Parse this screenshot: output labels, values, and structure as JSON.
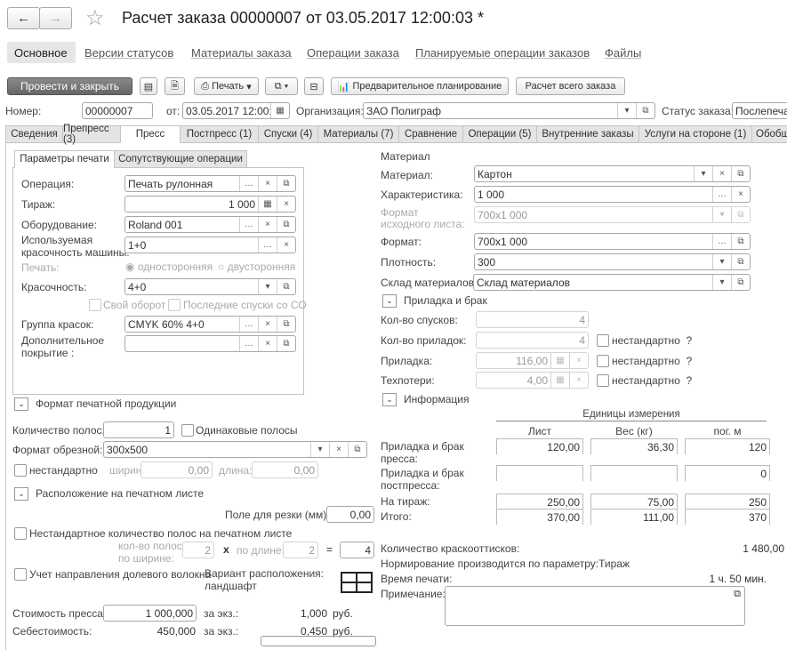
{
  "header": {
    "title": "Расчет заказа 00000007 от 03.05.2017 12:00:03 *",
    "back_icon": "arrow-left-icon",
    "forward_icon": "arrow-right-icon",
    "favorite_icon": "star-icon"
  },
  "nav": [
    "Основное",
    "Версии статусов",
    "Материалы заказа",
    "Операции заказа",
    "Планируемые операции заказов",
    "Файлы"
  ],
  "toolbar": {
    "post_close": "Провести и закрыть",
    "print": "Печать",
    "planning": "Предварительное планирование",
    "calc_all": "Расчет всего заказа"
  },
  "doc": {
    "number_label": "Номер:",
    "number": "00000007",
    "date_label": "от:",
    "date": "03.05.2017 12:00:0",
    "org_label": "Организация:",
    "org": "ЗАО Полиграф",
    "status_label": "Статус заказа:",
    "status": "Послепечат"
  },
  "tabs": [
    "Сведения",
    "Препресс (3)",
    "Пресс",
    "Постпресс (1)",
    "Спуски (4)",
    "Материалы (7)",
    "Сравнение",
    "Операции (5)",
    "Внутренние заказы",
    "Услуги на стороне (1)",
    "Обобщ"
  ],
  "subtabs": [
    "Параметры печати",
    "Сопутствующие операции"
  ],
  "params": {
    "operation_label": "Операция:",
    "operation": "Печать рулонная",
    "run_label": "Тираж:",
    "run": "1 000",
    "equipment_label": "Оборудование:",
    "equipment": "Roland 001",
    "machine_colors_label1": "Используемая",
    "machine_colors_label2": "красочность машины:",
    "machine_colors": "1+0",
    "print_label": "Печать:",
    "one_sided": "односторонняя",
    "two_sided": "двусторонняя",
    "colors_label": "Красочность:",
    "colors": "4+0",
    "own_turn": "Свой оборот",
    "last_co": "Последние спуски со СО",
    "ink_group_label": "Группа красок:",
    "ink_group": "CMYK 60%  4+0",
    "coating_label1": "Дополнительное",
    "coating_label2": "покрытие :",
    "coating": ""
  },
  "format": {
    "section": "Формат печатной продукции",
    "pages_label": "Количество полос:",
    "pages": "1",
    "same_pages": "Одинаковые полосы",
    "trim_label": "Формат обрезной:",
    "trim": "300x500",
    "nonstd": "нестандартно",
    "width_label": "ширина:",
    "width": "0,00",
    "length_label": "длина:",
    "length": "0,00"
  },
  "layout": {
    "section": "Расположение на печатном листе",
    "cut_label": "Поле для резки (мм):",
    "cut": "0,00",
    "nonstd_count": "Нестандартное количество полос на печатном листе",
    "by_width_label1": "кол-во полос",
    "by_width_label2": "по ширине:",
    "by_width": "2",
    "times": "x",
    "by_length_label": "по длине:",
    "by_length": "2",
    "eq": "=",
    "total": "4",
    "grain": "Учет направления долевого волокна",
    "variant_label": "Вариант расположения:",
    "variant": "ландшафт",
    "layout_icon": "grid-layout-icon"
  },
  "cost": {
    "press_cost_label": "Стоимость пресса:",
    "press_cost": "1 000,000",
    "per_copy": "за экз.:",
    "press_per_copy": "1,000",
    "currency": "руб.",
    "self_cost_label": "Себестоимость:",
    "self_cost": "450,000",
    "self_per_copy": "0,450"
  },
  "material": {
    "heading": "Материал",
    "material_label": "Материал:",
    "material": "Картон",
    "char_label": "Характеристика:",
    "char": "1 000",
    "src_format_label1": "Формат",
    "src_format_label2": "исходного листа:",
    "src_format": "700x1 000",
    "format_label": "Формат:",
    "format": "700x1 000",
    "density_label": "Плотность:",
    "density": "300",
    "warehouse_label": "Склад материалов:",
    "warehouse": "Склад материалов"
  },
  "makeready": {
    "section": "Приладка и брак",
    "impositions_label": "Кол-во спусков:",
    "impositions": "4",
    "makereadies_label": "Кол-во приладок:",
    "makereadies": "4",
    "makeready_label": "Приладка:",
    "makeready": "116,00",
    "waste_label": "Техпотери:",
    "waste": "4,00",
    "nonstd": "нестандартно",
    "help": "?"
  },
  "info": {
    "section": "Информация",
    "units_header": "Единицы измерения",
    "cols": [
      "Лист",
      "Вес (кг)",
      "пог. м"
    ],
    "rows": [
      {
        "l1": "Приладка и брак",
        "l2": "пресса:",
        "v": [
          "120,00",
          "36,30",
          "120"
        ]
      },
      {
        "l1": "Приладка и брак",
        "l2": "постпресса:",
        "v": [
          "",
          "",
          "0"
        ]
      },
      {
        "l1": "На тираж:",
        "l2": "",
        "v": [
          "250,00",
          "75,00",
          "250"
        ]
      },
      {
        "l1": "Итого:",
        "l2": "",
        "v": [
          "370,00",
          "111,00",
          "370"
        ]
      }
    ],
    "impressions_label": "Количество краскооттисков:",
    "impressions": "1 480,00",
    "norm_text": "Нормирование производится по параметру:Тираж",
    "time_label": "Время печати:",
    "time": "1 ч. 50 мин.",
    "note_label": "Примечание:",
    "note": ""
  }
}
